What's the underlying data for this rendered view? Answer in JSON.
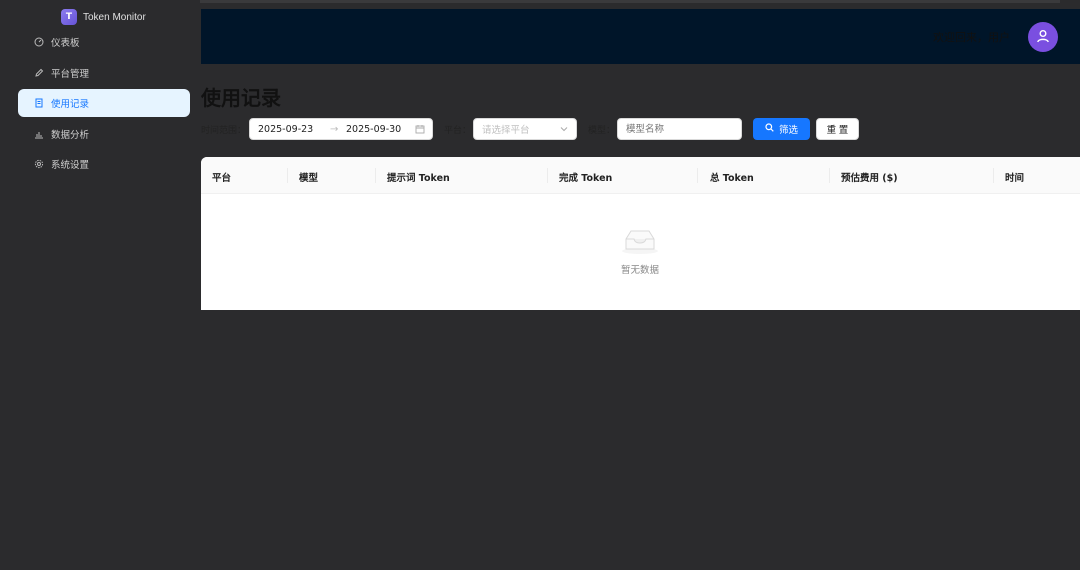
{
  "app": {
    "logo_letter": "T",
    "title": "Token Monitor"
  },
  "sidebar": {
    "items": [
      {
        "label": "仪表板",
        "icon": "dashboard-icon",
        "active": false
      },
      {
        "label": "平台管理",
        "icon": "edit-icon",
        "active": false
      },
      {
        "label": "使用记录",
        "icon": "file-text-icon",
        "active": true
      },
      {
        "label": "数据分析",
        "icon": "bar-chart-icon",
        "active": false
      },
      {
        "label": "系统设置",
        "icon": "gear-icon",
        "active": false
      }
    ]
  },
  "header": {
    "welcome": "欢迎回来，用户",
    "avatar_icon": "user-icon",
    "background": "#001529"
  },
  "page": {
    "title": "使用记录"
  },
  "filters": {
    "date_label": "时间范围：",
    "date_start": "2025-09-23",
    "date_end": "2025-09-30",
    "platform_label": "平台：",
    "platform_placeholder": "请选择平台",
    "model_label": "模型：",
    "model_placeholder": "模型名称",
    "filter_button": "筛选",
    "reset_button": "重 置"
  },
  "table": {
    "columns": [
      "平台",
      "模型",
      "提示词 Token",
      "完成 Token",
      "总 Token",
      "预估费用 ($)",
      "时间"
    ],
    "rows": [],
    "empty_text": "暂无数据"
  },
  "colors": {
    "primary": "#1677ff",
    "active_bg": "#e6f4ff",
    "avatar": "#7a4fe0"
  }
}
